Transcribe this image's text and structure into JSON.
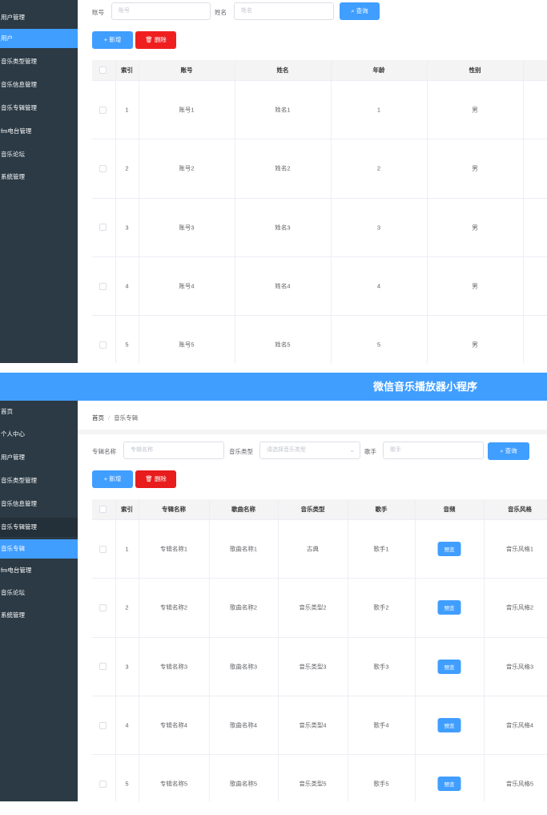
{
  "colors": {
    "sidebar": "#2b3a45",
    "active": "#409eff",
    "primary": "#409eff",
    "danger": "#f01f1f",
    "header": "#409eff"
  },
  "panel1": {
    "menu": [
      "用户管理",
      "用户",
      "音乐类型管理",
      "音乐信息管理",
      "音乐专辑管理",
      "fm电台管理",
      "音乐论坛",
      "系统管理"
    ],
    "search": {
      "account_label": "账号",
      "account_placeholder": "账号",
      "name_label": "姓名",
      "name_placeholder": "姓名",
      "search_button": "查询"
    },
    "actions": {
      "add": "新增",
      "delete": "删除"
    },
    "columns": [
      "索引",
      "账号",
      "姓名",
      "年龄",
      "性别"
    ],
    "rows": [
      [
        "1",
        "账号1",
        "姓名1",
        "1",
        "男"
      ],
      [
        "2",
        "账号2",
        "姓名2",
        "2",
        "男"
      ],
      [
        "3",
        "账号3",
        "姓名3",
        "3",
        "男"
      ],
      [
        "4",
        "账号4",
        "姓名4",
        "4",
        "男"
      ],
      [
        "5",
        "账号5",
        "姓名5",
        "5",
        "男"
      ]
    ]
  },
  "panel2": {
    "header_title": "微信音乐播放器小程序",
    "menu": [
      "首页",
      "个人中心",
      "用户管理",
      "音乐类型管理",
      "音乐信息管理",
      "音乐专辑管理",
      "音乐专辑",
      "fm电台管理",
      "音乐论坛",
      "系统管理"
    ],
    "breadcrumb": {
      "home": "首页",
      "separator": "/",
      "current": "音乐专辑"
    },
    "search": {
      "album_label": "专辑名称",
      "album_placeholder": "专辑名称",
      "type_label": "音乐类型",
      "type_placeholder": "请选择音乐类型",
      "singer_label": "歌手",
      "singer_placeholder": "歌手",
      "search_button": "查询"
    },
    "actions": {
      "add": "新增",
      "delete": "删除"
    },
    "columns": [
      "索引",
      "专辑名称",
      "歌曲名称",
      "音乐类型",
      "歌手",
      "音频",
      "音乐风格"
    ],
    "preview_label": "预览",
    "rows": [
      [
        "1",
        "专辑名称1",
        "歌曲名称1",
        "古典",
        "歌手1",
        "音乐风格1"
      ],
      [
        "2",
        "专辑名称2",
        "歌曲名称2",
        "音乐类型2",
        "歌手2",
        "音乐风格2"
      ],
      [
        "3",
        "专辑名称3",
        "歌曲名称3",
        "音乐类型3",
        "歌手3",
        "音乐风格3"
      ],
      [
        "4",
        "专辑名称4",
        "歌曲名称4",
        "音乐类型4",
        "歌手4",
        "音乐风格4"
      ],
      [
        "5",
        "专辑名称5",
        "歌曲名称5",
        "音乐类型5",
        "歌手5",
        "音乐风格5"
      ]
    ]
  }
}
